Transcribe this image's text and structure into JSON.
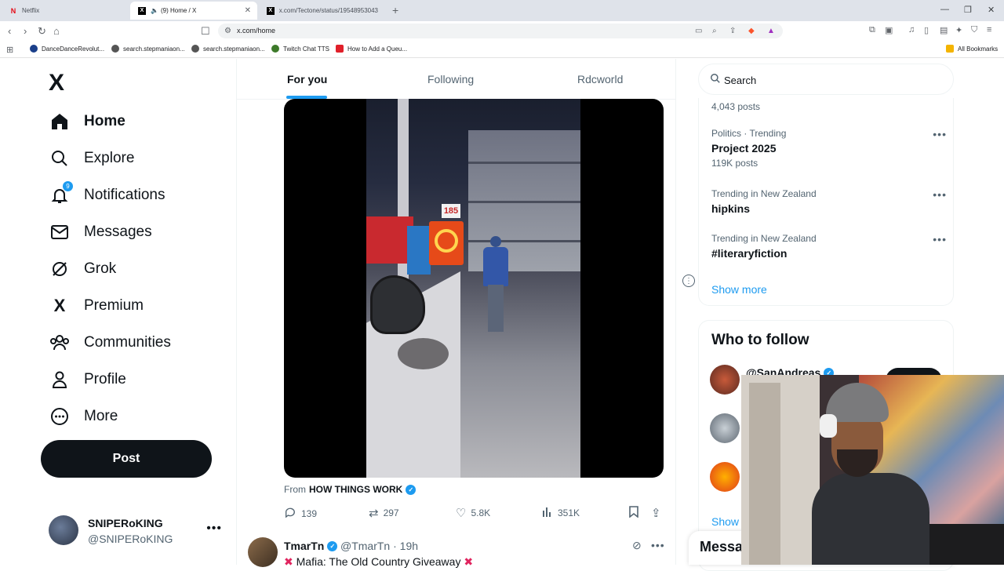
{
  "browser": {
    "tabs": [
      {
        "label": "Netflix",
        "icon": "netflix-icon",
        "active": false
      },
      {
        "label": "(9) Home / X",
        "icon": "x-icon",
        "active": true
      },
      {
        "label": "x.com/Tectone/status/19548953043",
        "icon": "x-icon",
        "active": false
      }
    ],
    "url": "x.com/home",
    "bookmarks": [
      {
        "label": "DanceDanceRevolut...",
        "color": "#1a3f8a"
      },
      {
        "label": "search.stepmaniaon...",
        "color": "#555555"
      },
      {
        "label": "search.stepmaniaon...",
        "color": "#555555"
      },
      {
        "label": "Twitch Chat TTS",
        "color": "#3d7a2a"
      },
      {
        "label": "How to Add a Queu...",
        "color": "#e0202a"
      }
    ],
    "all_bookmarks": "All Bookmarks"
  },
  "sidebar": {
    "logo": "X",
    "items": [
      {
        "label": "Home",
        "icon": "home-icon",
        "active": true
      },
      {
        "label": "Explore",
        "icon": "search-icon"
      },
      {
        "label": "Notifications",
        "icon": "bell-icon",
        "badge": "9"
      },
      {
        "label": "Messages",
        "icon": "envelope-icon"
      },
      {
        "label": "Grok",
        "icon": "grok-icon"
      },
      {
        "label": "Premium",
        "icon": "x-icon"
      },
      {
        "label": "Communities",
        "icon": "people-icon"
      },
      {
        "label": "Profile",
        "icon": "person-icon"
      },
      {
        "label": "More",
        "icon": "more-circle-icon"
      }
    ],
    "post_label": "Post",
    "account": {
      "name": "SNIPERoKING",
      "handle": "@SNIPERoKING"
    }
  },
  "feed": {
    "tabs": [
      "For you",
      "Following",
      "Rdcworld"
    ],
    "active_tab": "For you",
    "tweet": {
      "from_prefix": "From",
      "source": "HOW THINGS WORK",
      "video_price_sign": "185",
      "replies": "139",
      "reposts": "297",
      "likes": "5.8K",
      "views": "351K"
    },
    "next_tweet": {
      "name": "TmarTn",
      "handle": "@TmarTn · 19h",
      "text": "Mafia: The Old Country Giveaway"
    }
  },
  "right": {
    "search_placeholder": "Search",
    "first_count": "4,043 posts",
    "trends": [
      {
        "category": "Politics · Trending",
        "name": "Project 2025",
        "count": "119K posts"
      },
      {
        "category": "Trending in New Zealand",
        "name": "hipkins",
        "count": ""
      },
      {
        "category": "Trending in New Zealand",
        "name": "#literaryfiction",
        "count": ""
      }
    ],
    "show_more": "Show more",
    "who_to_follow": {
      "title": "Who to follow",
      "first_name": "@SanAndreas",
      "show_more": "Show more"
    },
    "messages_label": "Messages"
  },
  "colors": {
    "accent": "#1d9bf0",
    "text": "#0f1419",
    "muted": "#536471"
  }
}
